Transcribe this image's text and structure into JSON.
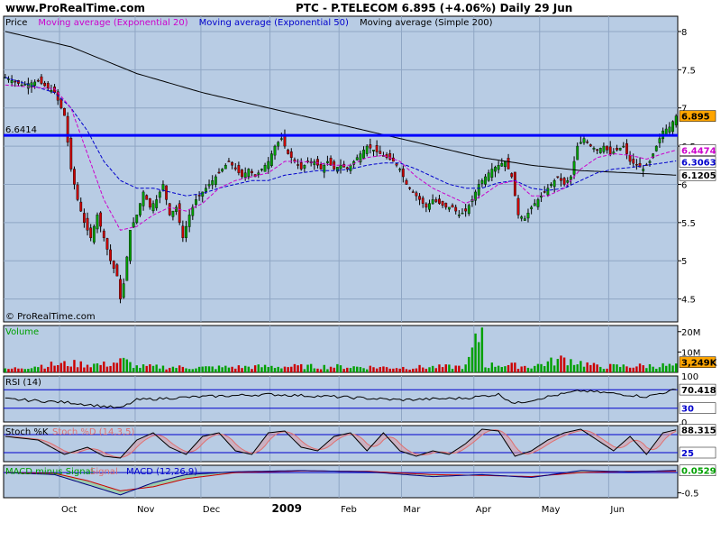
{
  "header": {
    "site": "www.ProRealTime.com",
    "title": "PTC - P.TELECOM    6.895 (+4.06%)    Daily  29 Jun"
  },
  "watermark": "© ProRealTime.com",
  "colors": {
    "panel_bg": "#b8cce4",
    "ema20": "#cc00cc",
    "ema50": "#0000cc",
    "sma200": "#000000",
    "hline": "#0000ff",
    "up": "#00a000",
    "down": "#cc0000",
    "rsi": "#000000",
    "stoch_k": "#000000",
    "stoch_d": "#e07070",
    "macd": "#000080",
    "signal": "#cc0000"
  },
  "chart_data": [
    {
      "name": "price",
      "type": "candlestick",
      "legend": [
        {
          "label": "Price",
          "color": "#000000"
        },
        {
          "label": "Moving average (Exponential 20)",
          "color": "#cc00cc"
        },
        {
          "label": "Moving average (Exponential 50)",
          "color": "#0000cc"
        },
        {
          "label": "Moving average (Simple 200)",
          "color": "#000000"
        }
      ],
      "ylim": [
        4.2,
        8.2
      ],
      "yticks": [
        4.5,
        5,
        5.5,
        6,
        6.5,
        7,
        7.5,
        8
      ],
      "x_labels": [
        {
          "label": "Oct",
          "bar": 17
        },
        {
          "label": "Nov",
          "bar": 40
        },
        {
          "label": "Dec",
          "bar": 60
        },
        {
          "label": "2009",
          "bar": 81
        },
        {
          "label": "Feb",
          "bar": 102
        },
        {
          "label": "Mar",
          "bar": 121
        },
        {
          "label": "Apr",
          "bar": 143
        },
        {
          "label": "May",
          "bar": 163
        },
        {
          "label": "Jun",
          "bar": 184
        }
      ],
      "price_anchors": [
        [
          0,
          7.4
        ],
        [
          5,
          7.3
        ],
        [
          10,
          7.35
        ],
        [
          15,
          7.2
        ],
        [
          18,
          6.9
        ],
        [
          20,
          6.2
        ],
        [
          22,
          5.8
        ],
        [
          24,
          5.5
        ],
        [
          26,
          5.3
        ],
        [
          28,
          5.6
        ],
        [
          30,
          5.3
        ],
        [
          32,
          5.0
        ],
        [
          34,
          4.8
        ],
        [
          35,
          4.5
        ],
        [
          36,
          4.7
        ],
        [
          38,
          5.4
        ],
        [
          40,
          5.6
        ],
        [
          42,
          5.9
        ],
        [
          44,
          5.7
        ],
        [
          46,
          5.8
        ],
        [
          48,
          6.0
        ],
        [
          50,
          5.6
        ],
        [
          52,
          5.7
        ],
        [
          54,
          5.3
        ],
        [
          56,
          5.6
        ],
        [
          58,
          5.8
        ],
        [
          60,
          5.9
        ],
        [
          62,
          6.0
        ],
        [
          64,
          6.1
        ],
        [
          66,
          6.2
        ],
        [
          68,
          6.3
        ],
        [
          70,
          6.2
        ],
        [
          72,
          6.1
        ],
        [
          74,
          6.2
        ],
        [
          76,
          6.1
        ],
        [
          78,
          6.2
        ],
        [
          80,
          6.3
        ],
        [
          82,
          6.5
        ],
        [
          84,
          6.6
        ],
        [
          86,
          6.4
        ],
        [
          88,
          6.3
        ],
        [
          90,
          6.2
        ],
        [
          92,
          6.3
        ],
        [
          94,
          6.3
        ],
        [
          96,
          6.2
        ],
        [
          98,
          6.3
        ],
        [
          100,
          6.2
        ],
        [
          102,
          6.25
        ],
        [
          104,
          6.2
        ],
        [
          106,
          6.3
        ],
        [
          108,
          6.4
        ],
        [
          110,
          6.5
        ],
        [
          112,
          6.45
        ],
        [
          114,
          6.4
        ],
        [
          116,
          6.35
        ],
        [
          118,
          6.3
        ],
        [
          120,
          6.2
        ],
        [
          122,
          6.0
        ],
        [
          124,
          5.9
        ],
        [
          126,
          5.8
        ],
        [
          128,
          5.7
        ],
        [
          130,
          5.8
        ],
        [
          132,
          5.75
        ],
        [
          134,
          5.7
        ],
        [
          136,
          5.7
        ],
        [
          138,
          5.6
        ],
        [
          140,
          5.65
        ],
        [
          142,
          5.8
        ],
        [
          144,
          6.0
        ],
        [
          146,
          6.1
        ],
        [
          148,
          6.2
        ],
        [
          150,
          6.25
        ],
        [
          152,
          6.3
        ],
        [
          154,
          6.1
        ],
        [
          156,
          5.6
        ],
        [
          158,
          5.55
        ],
        [
          160,
          5.7
        ],
        [
          162,
          5.8
        ],
        [
          164,
          5.9
        ],
        [
          166,
          6.0
        ],
        [
          168,
          6.1
        ],
        [
          170,
          6.0
        ],
        [
          172,
          6.1
        ],
        [
          174,
          6.5
        ],
        [
          176,
          6.6
        ],
        [
          178,
          6.5
        ],
        [
          180,
          6.45
        ],
        [
          182,
          6.5
        ],
        [
          184,
          6.4
        ],
        [
          186,
          6.45
        ],
        [
          188,
          6.5
        ],
        [
          190,
          6.3
        ],
        [
          192,
          6.25
        ],
        [
          194,
          6.2
        ],
        [
          196,
          6.3
        ],
        [
          198,
          6.5
        ],
        [
          200,
          6.7
        ],
        [
          202,
          6.75
        ],
        [
          204,
          6.895
        ]
      ],
      "ema20_anchors": [
        [
          0,
          7.3
        ],
        [
          15,
          7.25
        ],
        [
          20,
          7.0
        ],
        [
          25,
          6.4
        ],
        [
          30,
          5.8
        ],
        [
          35,
          5.4
        ],
        [
          40,
          5.45
        ],
        [
          45,
          5.6
        ],
        [
          50,
          5.7
        ],
        [
          55,
          5.65
        ],
        [
          60,
          5.75
        ],
        [
          65,
          5.95
        ],
        [
          70,
          6.05
        ],
        [
          75,
          6.1
        ],
        [
          80,
          6.15
        ],
        [
          85,
          6.3
        ],
        [
          90,
          6.3
        ],
        [
          95,
          6.28
        ],
        [
          100,
          6.25
        ],
        [
          105,
          6.25
        ],
        [
          110,
          6.35
        ],
        [
          115,
          6.38
        ],
        [
          120,
          6.3
        ],
        [
          125,
          6.1
        ],
        [
          130,
          5.95
        ],
        [
          135,
          5.85
        ],
        [
          140,
          5.75
        ],
        [
          145,
          5.85
        ],
        [
          150,
          6.0
        ],
        [
          155,
          6.05
        ],
        [
          160,
          5.85
        ],
        [
          165,
          5.85
        ],
        [
          170,
          5.95
        ],
        [
          175,
          6.2
        ],
        [
          180,
          6.35
        ],
        [
          185,
          6.4
        ],
        [
          190,
          6.38
        ],
        [
          195,
          6.33
        ],
        [
          200,
          6.4
        ],
        [
          204,
          6.4474
        ]
      ],
      "ema50_anchors": [
        [
          0,
          7.4
        ],
        [
          15,
          7.2
        ],
        [
          20,
          7.0
        ],
        [
          25,
          6.7
        ],
        [
          30,
          6.3
        ],
        [
          35,
          6.05
        ],
        [
          40,
          5.95
        ],
        [
          45,
          5.95
        ],
        [
          50,
          5.9
        ],
        [
          55,
          5.85
        ],
        [
          60,
          5.88
        ],
        [
          65,
          5.95
        ],
        [
          70,
          6.0
        ],
        [
          75,
          6.05
        ],
        [
          80,
          6.05
        ],
        [
          85,
          6.12
        ],
        [
          90,
          6.15
        ],
        [
          95,
          6.18
        ],
        [
          100,
          6.18
        ],
        [
          105,
          6.2
        ],
        [
          110,
          6.25
        ],
        [
          115,
          6.28
        ],
        [
          120,
          6.28
        ],
        [
          125,
          6.2
        ],
        [
          130,
          6.1
        ],
        [
          135,
          6.0
        ],
        [
          140,
          5.95
        ],
        [
          145,
          5.95
        ],
        [
          150,
          6.02
        ],
        [
          155,
          6.05
        ],
        [
          160,
          5.95
        ],
        [
          165,
          5.92
        ],
        [
          170,
          5.95
        ],
        [
          175,
          6.05
        ],
        [
          180,
          6.15
        ],
        [
          185,
          6.2
        ],
        [
          190,
          6.22
        ],
        [
          195,
          6.25
        ],
        [
          200,
          6.28
        ],
        [
          204,
          6.3063
        ]
      ],
      "sma200_anchors": [
        [
          0,
          8.0
        ],
        [
          20,
          7.8
        ],
        [
          40,
          7.45
        ],
        [
          60,
          7.2
        ],
        [
          80,
          7.0
        ],
        [
          100,
          6.8
        ],
        [
          115,
          6.65
        ],
        [
          130,
          6.5
        ],
        [
          145,
          6.35
        ],
        [
          160,
          6.25
        ],
        [
          175,
          6.18
        ],
        [
          190,
          6.15
        ],
        [
          204,
          6.1205
        ]
      ],
      "hline": {
        "value": 6.6414,
        "label": "6.6414"
      },
      "right_labels": [
        {
          "value": 6.895,
          "label": "6.895",
          "bg": "#ffa500",
          "fg": "#000000"
        },
        {
          "value": 6.4474,
          "label": "6.4474",
          "bg": "#ffffff",
          "fg": "#cc00cc"
        },
        {
          "value": 6.3063,
          "label": "6.3063",
          "bg": "#ffffff",
          "fg": "#0000cc"
        },
        {
          "value": 6.1205,
          "label": "6.1205",
          "bg": "#ffffff",
          "fg": "#000000"
        }
      ]
    },
    {
      "name": "volume",
      "type": "bar",
      "legend": [
        {
          "label": "Volume",
          "color": "#00a000"
        }
      ],
      "ylim": [
        0,
        23
      ],
      "yticks": [
        {
          "value": 10,
          "label": "10M"
        },
        {
          "value": 20,
          "label": "20M"
        }
      ],
      "volume_anchors": [
        [
          0,
          1.5
        ],
        [
          10,
          3.5
        ],
        [
          20,
          4.5
        ],
        [
          30,
          4.0
        ],
        [
          36,
          6.0
        ],
        [
          40,
          3.0
        ],
        [
          60,
          2.5
        ],
        [
          80,
          3.0
        ],
        [
          100,
          3.0
        ],
        [
          120,
          2.5
        ],
        [
          140,
          3.0
        ],
        [
          145,
          22.0
        ],
        [
          146,
          3.5
        ],
        [
          150,
          4.0
        ],
        [
          160,
          3.0
        ],
        [
          170,
          7.0
        ],
        [
          180,
          3.0
        ],
        [
          200,
          3.5
        ],
        [
          204,
          3.249
        ]
      ],
      "right_label": {
        "value": 3.249,
        "label": "3,249K",
        "bg": "#ffa500",
        "fg": "#000000"
      }
    },
    {
      "name": "rsi",
      "type": "line",
      "legend": [
        {
          "label": "RSI (14)",
          "color": "#000000"
        }
      ],
      "ylim": [
        0,
        100
      ],
      "yticks": [
        0,
        100
      ],
      "levels": [
        30,
        70
      ],
      "rsi_anchors": [
        [
          0,
          50
        ],
        [
          20,
          42
        ],
        [
          35,
          30
        ],
        [
          40,
          48
        ],
        [
          50,
          52
        ],
        [
          60,
          55
        ],
        [
          80,
          60
        ],
        [
          100,
          55
        ],
        [
          120,
          48
        ],
        [
          140,
          52
        ],
        [
          150,
          60
        ],
        [
          155,
          40
        ],
        [
          165,
          55
        ],
        [
          175,
          68
        ],
        [
          185,
          62
        ],
        [
          195,
          55
        ],
        [
          204,
          70.418
        ]
      ],
      "right_labels": [
        {
          "value": 70.418,
          "label": "70.418",
          "bg": "#ffffff",
          "fg": "#000000"
        },
        {
          "value": 30,
          "label": "30",
          "bg": "#ffffff",
          "fg": "#0000cc"
        }
      ]
    },
    {
      "name": "stochastic",
      "type": "line",
      "legend": [
        {
          "label": "Stoch %K",
          "color": "#000000"
        },
        {
          "label": "Stoch %D (14,3,5)",
          "color": "#e07070"
        }
      ],
      "ylim": [
        0,
        100
      ],
      "levels": [
        25,
        75
      ],
      "stoch_k_anchors": [
        [
          0,
          70
        ],
        [
          10,
          60
        ],
        [
          18,
          20
        ],
        [
          25,
          40
        ],
        [
          30,
          15
        ],
        [
          35,
          10
        ],
        [
          40,
          60
        ],
        [
          45,
          80
        ],
        [
          50,
          40
        ],
        [
          55,
          20
        ],
        [
          60,
          70
        ],
        [
          65,
          80
        ],
        [
          70,
          30
        ],
        [
          75,
          20
        ],
        [
          80,
          80
        ],
        [
          85,
          85
        ],
        [
          90,
          40
        ],
        [
          95,
          30
        ],
        [
          100,
          70
        ],
        [
          105,
          80
        ],
        [
          110,
          30
        ],
        [
          115,
          80
        ],
        [
          120,
          30
        ],
        [
          125,
          15
        ],
        [
          130,
          30
        ],
        [
          135,
          20
        ],
        [
          140,
          50
        ],
        [
          145,
          90
        ],
        [
          150,
          85
        ],
        [
          155,
          15
        ],
        [
          160,
          30
        ],
        [
          165,
          60
        ],
        [
          170,
          80
        ],
        [
          175,
          90
        ],
        [
          180,
          60
        ],
        [
          185,
          30
        ],
        [
          190,
          70
        ],
        [
          195,
          20
        ],
        [
          200,
          80
        ],
        [
          204,
          88.315
        ]
      ],
      "right_labels": [
        {
          "value": 88.315,
          "label": "88.315",
          "bg": "#ffffff",
          "fg": "#000000"
        },
        {
          "value": 25,
          "label": "25",
          "bg": "#ffffff",
          "fg": "#0000cc"
        }
      ]
    },
    {
      "name": "macd",
      "type": "line",
      "legend": [
        {
          "label": "MACD minus Signal",
          "color": "#00a000"
        },
        {
          "label": "Signal",
          "color": "#e07070"
        },
        {
          "label": "MACD (12,26,9)",
          "color": "#0000cc"
        }
      ],
      "ylim": [
        -0.62,
        0.18
      ],
      "yticks": [
        {
          "value": -0.5,
          "label": "-0.5"
        }
      ],
      "macd_anchors": [
        [
          0,
          0.0
        ],
        [
          15,
          -0.05
        ],
        [
          25,
          -0.3
        ],
        [
          35,
          -0.55
        ],
        [
          45,
          -0.25
        ],
        [
          55,
          -0.05
        ],
        [
          70,
          0.02
        ],
        [
          90,
          0.05
        ],
        [
          110,
          0.02
        ],
        [
          130,
          -0.1
        ],
        [
          145,
          -0.05
        ],
        [
          160,
          -0.12
        ],
        [
          175,
          0.05
        ],
        [
          190,
          0.02
        ],
        [
          204,
          0.0529
        ]
      ],
      "signal_anchors": [
        [
          0,
          0.0
        ],
        [
          15,
          -0.02
        ],
        [
          25,
          -0.2
        ],
        [
          35,
          -0.45
        ],
        [
          45,
          -0.35
        ],
        [
          55,
          -0.15
        ],
        [
          70,
          0.0
        ],
        [
          90,
          0.04
        ],
        [
          110,
          0.03
        ],
        [
          130,
          -0.05
        ],
        [
          145,
          -0.07
        ],
        [
          160,
          -0.1
        ],
        [
          175,
          0.0
        ],
        [
          190,
          0.03
        ],
        [
          204,
          0.03
        ]
      ],
      "right_label": {
        "value": 0.0529,
        "label": "0.0529",
        "bg": "#ffffff",
        "fg": "#00a000"
      }
    }
  ]
}
